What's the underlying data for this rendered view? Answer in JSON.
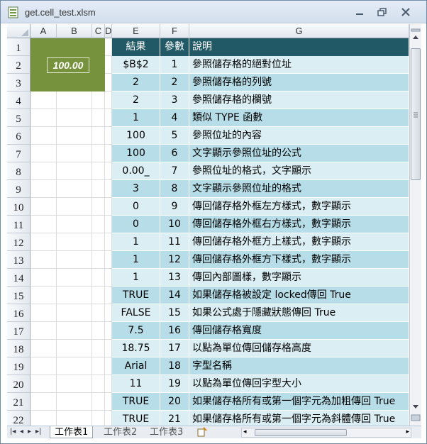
{
  "window": {
    "title": "get.cell_test.xlsm"
  },
  "columns": [
    "A",
    "B",
    "C",
    "D",
    "E",
    "F",
    "G"
  ],
  "rows": [
    "1",
    "2",
    "3",
    "4",
    "5",
    "6",
    "7",
    "8",
    "9",
    "10",
    "11",
    "12",
    "13",
    "14",
    "15",
    "16",
    "17",
    "18",
    "19",
    "20",
    "21",
    "22"
  ],
  "cell_b2": "100.00",
  "table": {
    "headers": [
      "結果",
      "參數",
      "說明"
    ],
    "rows": [
      [
        "$B$2",
        "1",
        "參照儲存格的絕對位址"
      ],
      [
        "2",
        "2",
        "參照儲存格的列號"
      ],
      [
        "2",
        "3",
        "參照儲存格的欄號"
      ],
      [
        "1",
        "4",
        "類似 TYPE 函數"
      ],
      [
        "100",
        "5",
        "參照位址的內容"
      ],
      [
        "100",
        "6",
        "文字顯示參照位址的公式"
      ],
      [
        "0.00_",
        "7",
        "參照位址的格式，文字顯示"
      ],
      [
        "3",
        "8",
        "文字顯示參照位址的格式"
      ],
      [
        "0",
        "9",
        "傳回儲存格外框左方樣式，數字顯示"
      ],
      [
        "0",
        "10",
        " 傳回儲存格外框右方樣式，數字顯示"
      ],
      [
        "1",
        "11",
        "傳回儲存格外框方上樣式，數字顯示"
      ],
      [
        "1",
        "12",
        "傳回儲存格外框方下樣式，數字顯示"
      ],
      [
        "1",
        "13",
        "傳回內部圖樣，數字顯示"
      ],
      [
        "TRUE",
        "14",
        " 如果儲存格被設定 locked傳回 True"
      ],
      [
        "FALSE",
        "15",
        "如果公式處于隱藏狀態傳回 True"
      ],
      [
        "7.5",
        "16",
        "傳回儲存格寬度"
      ],
      [
        "18.75",
        "17",
        "以點為單位傳回儲存格高度"
      ],
      [
        "Arial",
        "18",
        "字型名稱"
      ],
      [
        "11",
        "19",
        "以點為單位傳回字型大小"
      ],
      [
        "TRUE",
        "20",
        "如果儲存格所有或第一個字元為加粗傳回 True"
      ],
      [
        "TRUE",
        "21",
        "如果儲存格所有或第一個字元為斜體傳回 True"
      ]
    ]
  },
  "sheets": [
    "工作表1",
    "工作表2",
    "工作表3"
  ],
  "active_sheet": "工作表1",
  "colors": {
    "header": "#215967",
    "band_light": "#daeef3",
    "band_dark": "#b7dee8",
    "cell_fill": "#76923c"
  }
}
